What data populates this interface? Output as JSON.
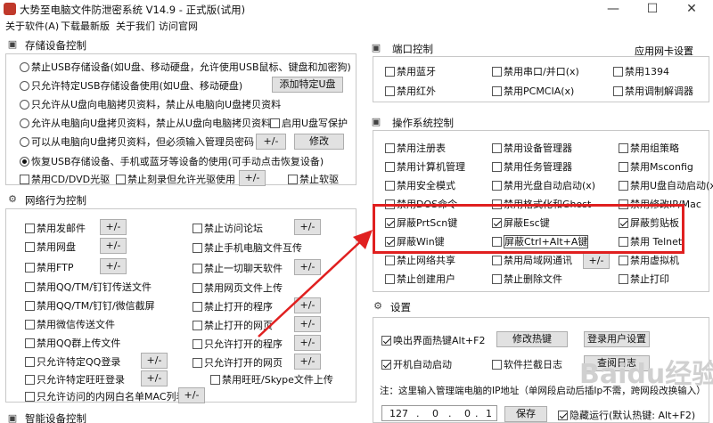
{
  "window": {
    "title": "大势至电脑文件防泄密系统 V14.9 - 正式版(试用)",
    "minimize": "—",
    "maximize": "☐",
    "close": "✕"
  },
  "menu": [
    "关于软件(A)",
    "下载最新版",
    "关于我们",
    "访问官网"
  ],
  "storage": {
    "title": "存储设备控制",
    "opt1": "禁止USB存储设备(如U盘、移动硬盘，允许使用USB鼠标、键盘和加密狗)",
    "opt2": "只允许特定USB存储设备使用(如U盘、移动硬盘)",
    "btn_add_udisk": "添加特定U盘",
    "opt3": "只允许从U盘向电脑拷贝资料，禁止从电脑向U盘拷贝资料",
    "opt4": "允许从电脑向U盘拷贝资料，禁止从U盘向电脑拷贝资料",
    "chk_write_protect": "启用U盘写保护",
    "opt5": "可以从电脑向U盘拷贝资料，但必须输入管理员密码",
    "btn_pm": "+/-",
    "btn_modify": "修改",
    "opt6": "恢复USB存储设备、手机或蓝牙等设备的使用(可手动点击恢复设备)",
    "chk_cd": "禁用CD/DVD光驱",
    "chk_burn": "禁止刻录但允许光驱使用",
    "btn_burn_pm": "+/-",
    "chk_floppy": "禁止软驱"
  },
  "network": {
    "title": "网络行为控制",
    "left": [
      {
        "label": "禁用发邮件",
        "btn": "+/-"
      },
      {
        "label": "禁用网盘",
        "btn": "+/-"
      },
      {
        "label": "禁用FTP",
        "btn": "+/-"
      },
      {
        "label": "禁用QQ/TM/钉钉传送文件",
        "btn": ""
      },
      {
        "label": "禁用QQ/TM/钉钉/微信截屏",
        "btn": ""
      },
      {
        "label": "禁用微信传送文件",
        "btn": ""
      },
      {
        "label": "禁用QQ群上传文件",
        "btn": ""
      },
      {
        "label": "只允许特定QQ登录",
        "btn": "+/-"
      },
      {
        "label": "只允许特定旺旺登录",
        "btn": "+/-"
      },
      {
        "label": "只允许访问的内网白名单MAC列表",
        "btn": "+/-"
      }
    ],
    "right": [
      {
        "label": "禁止访问论坛",
        "btn": "+/-"
      },
      {
        "label": "禁止手机电脑文件互传",
        "btn": ""
      },
      {
        "label": "禁止一切聊天软件",
        "btn": "+/-"
      },
      {
        "label": "禁用网页文件上传",
        "btn": ""
      },
      {
        "label": "禁止打开的程序",
        "btn": "+/-"
      },
      {
        "label": "禁止打开的网页",
        "btn": "+/-"
      },
      {
        "label": "只允许打开的程序",
        "btn": "+/-"
      },
      {
        "label": "只允许打开的网页",
        "btn": "+/-"
      }
    ],
    "skype": "禁用旺旺/Skype文件上传"
  },
  "smart": {
    "title": "智能设备控制"
  },
  "port": {
    "title": "端口控制",
    "nic_link": "应用网卡设置",
    "items": [
      [
        "禁用蓝牙",
        "禁用串口/并口(x)",
        "禁用1394"
      ],
      [
        "禁用红外",
        "禁用PCMCIA(x)",
        "禁用调制解调器"
      ]
    ]
  },
  "os": {
    "title": "操作系统控制",
    "items": [
      [
        "禁用注册表",
        "禁用设备管理器",
        "禁用组策略"
      ],
      [
        "禁用计算机管理",
        "禁用任务管理器",
        "禁用Msconfig"
      ],
      [
        "禁用安全模式",
        "禁用光盘自动启动(x)",
        "禁用U盘自动启动(x)"
      ],
      [
        "禁用DOS命令",
        "禁用格式化和Ghost",
        "禁用修改IP/Mac"
      ],
      [
        "屏蔽PrtScn键",
        "屏蔽Esc键",
        "屏蔽剪贴板"
      ],
      [
        "屏蔽Win键",
        "屏蔽Ctrl+Alt+A键",
        "禁用 Telnet"
      ],
      [
        "禁止网络共享",
        "禁用局域网通讯",
        "禁用虚拟机"
      ],
      [
        "禁止创建用户",
        "禁止删除文件",
        "禁止打印"
      ]
    ],
    "checked": [
      [
        false,
        false,
        false
      ],
      [
        false,
        false,
        false
      ],
      [
        false,
        false,
        false
      ],
      [
        false,
        false,
        false
      ],
      [
        true,
        true,
        true
      ],
      [
        true,
        false,
        false
      ],
      [
        false,
        false,
        false
      ],
      [
        false,
        false,
        false
      ]
    ],
    "lan_btn": "+/-"
  },
  "settings": {
    "title": "设置",
    "chk_hotkey": "唤出界面热键Alt+F2",
    "btn_hotkey": "修改热键",
    "btn_login": "登录用户设置",
    "chk_autostart": "开机自动启动",
    "chk_log": "软件拦截日志",
    "btn_log": "查阅日志",
    "note": "注：这里输入管理端电脑的IP地址（单网段启动后插Ip不需，跨网段改换输入）",
    "ip": [
      "127",
      ".",
      "0",
      ".",
      "0",
      ".",
      "1"
    ],
    "btn_save": "保存",
    "chk_hidden": "隐藏运行(默认热键: Alt+F2)"
  },
  "watermark": "Baidu经验"
}
